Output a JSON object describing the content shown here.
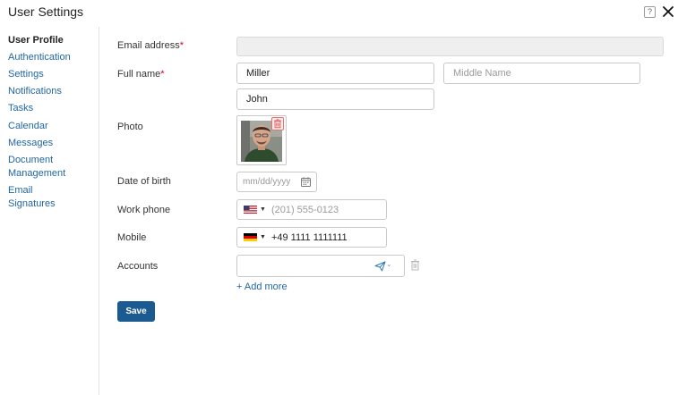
{
  "header": {
    "title": "User Settings",
    "help_glyph": "?",
    "help_icon": "help-icon",
    "close_icon": "close-icon"
  },
  "sidebar": {
    "items": [
      {
        "label": "User Profile",
        "active": true
      },
      {
        "label": "Authentication"
      },
      {
        "label": "Settings"
      },
      {
        "label": "Notifications"
      },
      {
        "label": "Tasks"
      },
      {
        "label": "Calendar"
      },
      {
        "label": "Messages"
      },
      {
        "label": "Document Management"
      },
      {
        "label": "Email Signatures"
      }
    ]
  },
  "form": {
    "email": {
      "label": "Email address",
      "required_mark": "*",
      "value": "",
      "disabled": true
    },
    "full_name": {
      "label": "Full name",
      "required_mark": "*",
      "last_name_value": "Miller",
      "middle_name_placeholder": "Middle Name",
      "first_name_value": "John"
    },
    "photo": {
      "label": "Photo",
      "delete_icon": "trash-icon"
    },
    "date_of_birth": {
      "label": "Date of birth",
      "placeholder": "mm/dd/yyyy",
      "icon": "calendar-icon"
    },
    "work_phone": {
      "label": "Work phone",
      "country_flag": "us-flag-icon",
      "placeholder": "(201) 555-0123"
    },
    "mobile": {
      "label": "Mobile",
      "country_flag": "de-flag-icon",
      "value": "+49 1111 1111111"
    },
    "accounts": {
      "label": "Accounts",
      "value": "",
      "messenger_icon": "send-icon",
      "delete_icon": "trash-icon"
    },
    "add_more_label": "+ Add more",
    "save_label": "Save"
  },
  "colors": {
    "link": "#2167a1",
    "primary_button": "#1c5b91",
    "required": "#d0021b",
    "border": "#c9c9c9"
  }
}
